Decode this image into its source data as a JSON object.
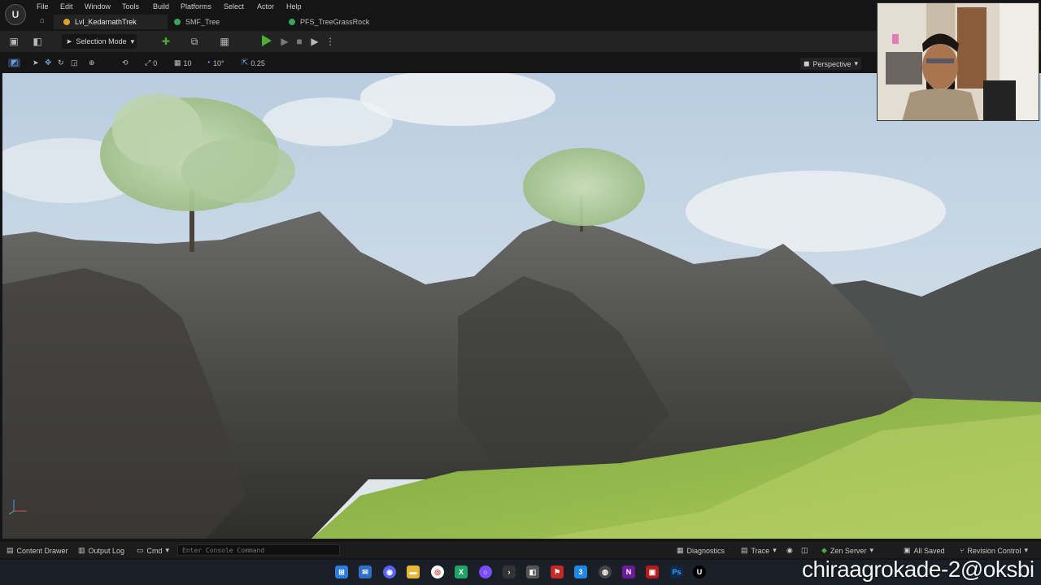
{
  "menu": {
    "items": [
      "File",
      "Edit",
      "Window",
      "Tools",
      "Build",
      "Platforms",
      "Select",
      "Actor",
      "Help"
    ]
  },
  "tabs": [
    {
      "label": "Lvl_KedarnathTrek",
      "icon": "level-icon",
      "color": "#e0a030"
    },
    {
      "label": "SMF_Tree",
      "icon": "mesh-icon",
      "color": "#3aa25a"
    },
    {
      "label": "PFS_TreeGrassRock",
      "icon": "mesh-icon",
      "color": "#3aa25a"
    }
  ],
  "toolbar": {
    "selection_mode": "Selection Mode"
  },
  "viewport_toolbar": {
    "rotation_snap": "0",
    "grid_snap": "10",
    "angle_snap": "10°",
    "scale_snap": "0.25",
    "view_mode": "Perspective"
  },
  "statusbar": {
    "content_drawer": "Content Drawer",
    "output_log": "Output Log",
    "cmd": "Cmd",
    "console_placeholder": "Enter Console Command",
    "diagnostics": "Diagnostics",
    "trace": "Trace",
    "zen_server": "Zen Server",
    "all_saved": "All Saved",
    "revision_control": "Revision Control"
  },
  "overlay": {
    "text": "chiraagrokade-2@oksbi"
  },
  "colors": {
    "accent_play": "#4caf34",
    "sky": "#c9d9e6",
    "grass": "#8fb04a"
  }
}
